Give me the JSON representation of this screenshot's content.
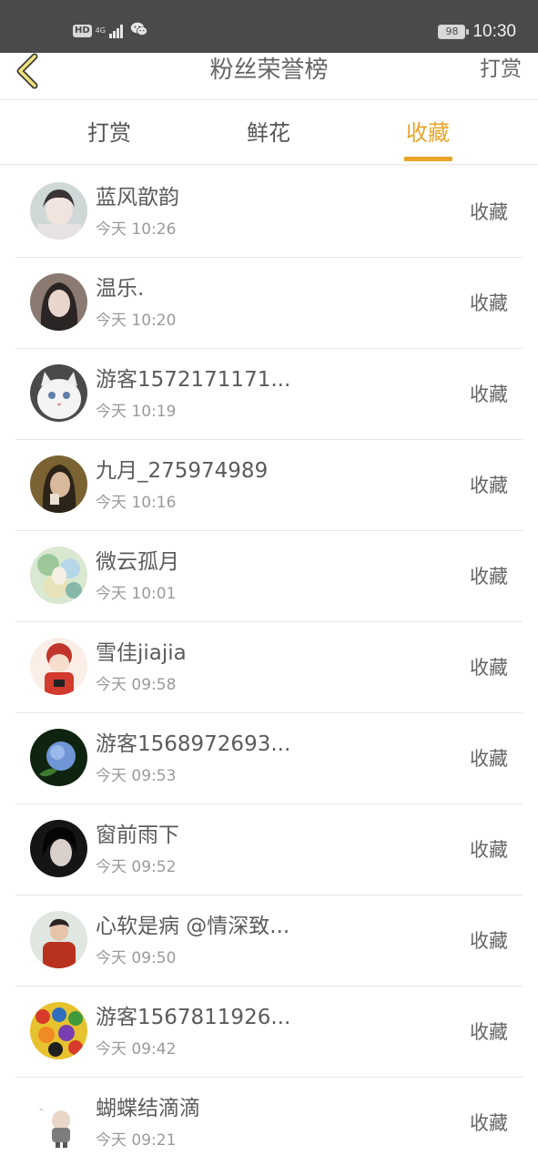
{
  "status_bar": {
    "hd_label": "HD",
    "network_label": "4G",
    "battery_level": "98",
    "time": "10:30"
  },
  "header": {
    "title": "粉丝荣誉榜",
    "right_action": "打赏",
    "back_icon": "chevron-left-icon"
  },
  "tabs": [
    {
      "label": "打赏",
      "active": false
    },
    {
      "label": "鲜花",
      "active": false
    },
    {
      "label": "收藏",
      "active": true
    }
  ],
  "accent_color": "#e8a52a",
  "fans": [
    {
      "name": "蓝风歆韵",
      "time": "今天 10:26",
      "action": "收藏"
    },
    {
      "name": "温乐.",
      "time": "今天 10:20",
      "action": "收藏"
    },
    {
      "name": "游客1572171171...",
      "time": "今天 10:19",
      "action": "收藏"
    },
    {
      "name": "九月_275974989",
      "time": "今天 10:16",
      "action": "收藏"
    },
    {
      "name": "微云孤月",
      "time": "今天 10:01",
      "action": "收藏"
    },
    {
      "name": "雪佳jiajia",
      "time": "今天 09:58",
      "action": "收藏"
    },
    {
      "name": "游客1568972693...",
      "time": "今天 09:53",
      "action": "收藏"
    },
    {
      "name": "窗前雨下",
      "time": "今天 09:52",
      "action": "收藏"
    },
    {
      "name": "心软是病 @情深致...",
      "time": "今天 09:50",
      "action": "收藏"
    },
    {
      "name": "游客1567811926...",
      "time": "今天 09:42",
      "action": "收藏"
    },
    {
      "name": "蝴蝶结滴滴",
      "time": "今天 09:21",
      "action": "收藏"
    }
  ]
}
